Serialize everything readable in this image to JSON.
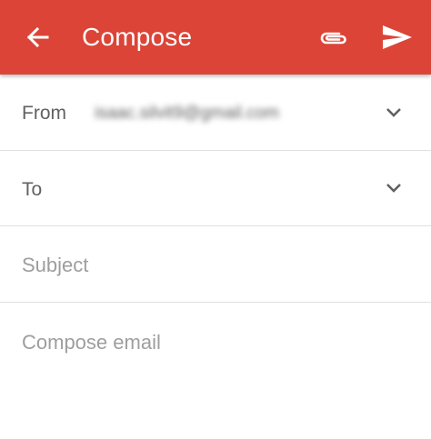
{
  "colors": {
    "appbar": "#db4437",
    "appbar_text": "#ffffff",
    "divider": "#e0e0e0",
    "label_text": "#616161",
    "hint_text": "#9e9e9e"
  },
  "appbar": {
    "title": "Compose",
    "back_icon": "arrow-back-icon",
    "attach_icon": "paperclip-icon",
    "send_icon": "send-icon"
  },
  "from": {
    "label": "From",
    "value": "isaac.silvit9@gmail.com",
    "value_state": "blurred",
    "expand_icon": "chevron-down-icon"
  },
  "to": {
    "label": "To",
    "expand_icon": "chevron-down-icon"
  },
  "subject": {
    "placeholder": "Subject"
  },
  "body": {
    "placeholder": "Compose email"
  }
}
